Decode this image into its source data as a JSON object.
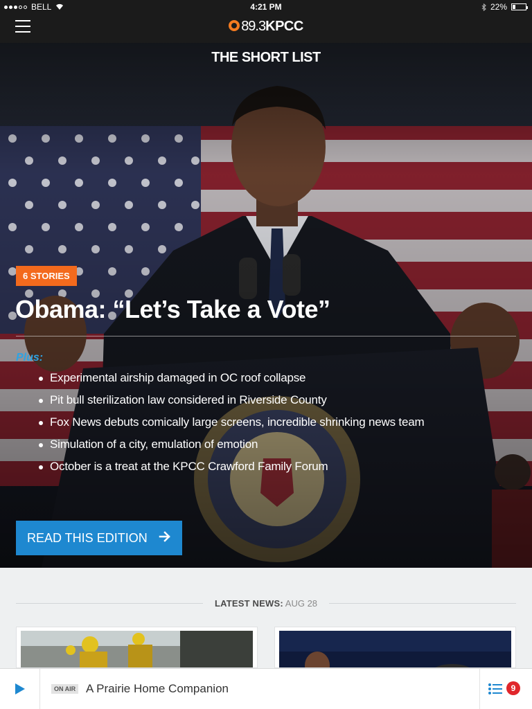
{
  "status_bar": {
    "carrier": "BELL",
    "time": "4:21 PM",
    "battery": "22%",
    "battery_level": 0.22,
    "icons": [
      "signal-dots-icon",
      "wifi-icon",
      "bluetooth-icon",
      "battery-icon"
    ]
  },
  "nav": {
    "menu_icon": "hamburger-menu-icon",
    "logo_freq": "89.3",
    "logo_name": "KPCC",
    "logo_color": "#f47b20"
  },
  "hero": {
    "section_title": "THE SHORT LIST",
    "badge": "6 STORIES",
    "headline": "Obama: “Let’s Take a Vote”",
    "plus_label": "Plus:",
    "stories": [
      "Experimental airship damaged in OC roof collapse",
      "Pit bull sterilization law considered in Riverside County",
      "Fox News debuts comically large screens, incredible shrinking news team",
      "Simulation of a city, emulation of emotion",
      "October is a treat at the KPCC Crawford Family Forum"
    ],
    "cta_label": "READ THIS EDITION",
    "cta_icon": "arrow-right-icon",
    "accent_orange": "#f36a1d",
    "accent_blue": "#1e88d0"
  },
  "latest": {
    "label": "LATEST NEWS:",
    "date": "AUG 28"
  },
  "player": {
    "play_icon": "play-icon",
    "onair_label": "ON AIR",
    "show_title": "A Prairie Home Companion",
    "queue_icon": "queue-list-icon",
    "queue_count": "9"
  }
}
